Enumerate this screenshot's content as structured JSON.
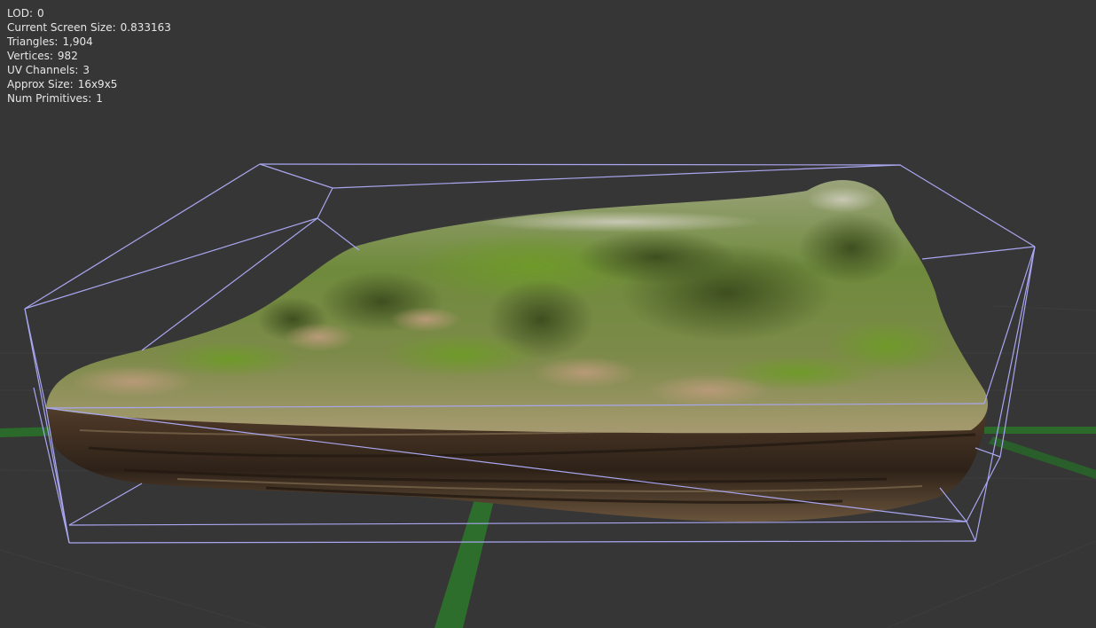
{
  "viewport": {
    "background_color": "#363636",
    "grid_line_color": "#3c3c3c",
    "axis_x_color": "#2a6a2a",
    "axis_y_color": "#2d6e2d",
    "bounds_color": "#a9a6f0",
    "mesh": "moss-covered rock scan"
  },
  "stats": [
    {
      "label": "LOD",
      "value": "0"
    },
    {
      "label": "Current Screen Size",
      "value": "0.833163"
    },
    {
      "label": "Triangles",
      "value": "1,904"
    },
    {
      "label": "Vertices",
      "value": "982"
    },
    {
      "label": "UV Channels",
      "value": "3"
    },
    {
      "label": "Approx Size",
      "value": "16x9x5"
    },
    {
      "label": "Num Primitives",
      "value": "1"
    }
  ]
}
